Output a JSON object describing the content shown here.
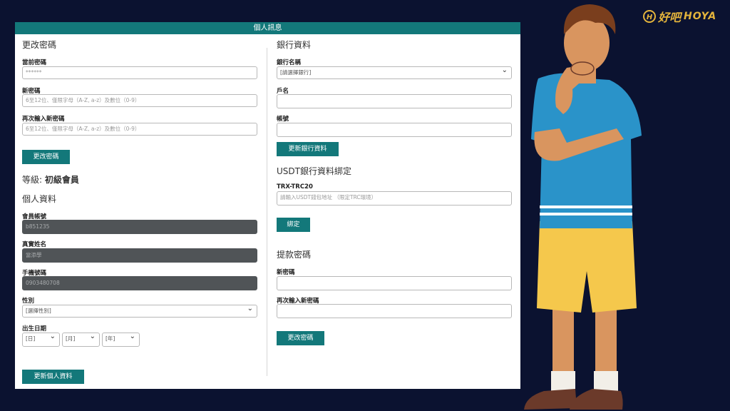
{
  "header": {
    "title": "個人訊息"
  },
  "change_password": {
    "title": "更改密碼",
    "current_label": "當前密碼",
    "current_placeholder": "******",
    "new_label": "新密碼",
    "new_placeholder": "6至12位、僅限字母（A-Z, a-z）及數位（0-9）",
    "confirm_label": "再次輸入新密碼",
    "confirm_placeholder": "6至12位、僅限字母（A-Z, a-z）及數位（0-9）",
    "button": "更改密碼"
  },
  "level": {
    "prefix": "等級: ",
    "value": "初級會員"
  },
  "personal": {
    "title": "個人資料",
    "account_label": "會員帳號",
    "account_value": "b851235",
    "realname_label": "真實姓名",
    "realname_value": "當添學",
    "phone_label": "手機號碼",
    "phone_value": "0903480708",
    "gender_label": "性別",
    "gender_value": "[選擇性別]",
    "birthday_label": "出生日期",
    "day_value": "[日]",
    "month_value": "[月]",
    "year_value": "[年]",
    "button": "更新個人資料"
  },
  "bank": {
    "title": "銀行資料",
    "bank_name_label": "銀行名稱",
    "bank_name_value": "[請選擇銀行]",
    "holder_label": "戶名",
    "account_label": "帳號",
    "button": "更新銀行資料"
  },
  "usdt": {
    "title": "USDT銀行資料綁定",
    "trc_label": "TRX-TRC20",
    "trc_placeholder": "請輸入USDT錢包地址 （限定TRC環境）",
    "button": "綁定"
  },
  "withdraw_password": {
    "title": "提款密碼",
    "new_label": "新密碼",
    "confirm_label": "再次輸入新密碼",
    "button": "更改密碼"
  },
  "logo": {
    "mark": "H",
    "cn": "好吧",
    "en": "HOYA"
  },
  "colors": {
    "accent": "#13787a",
    "background": "#0b1230",
    "logo": "#e4b43c"
  }
}
